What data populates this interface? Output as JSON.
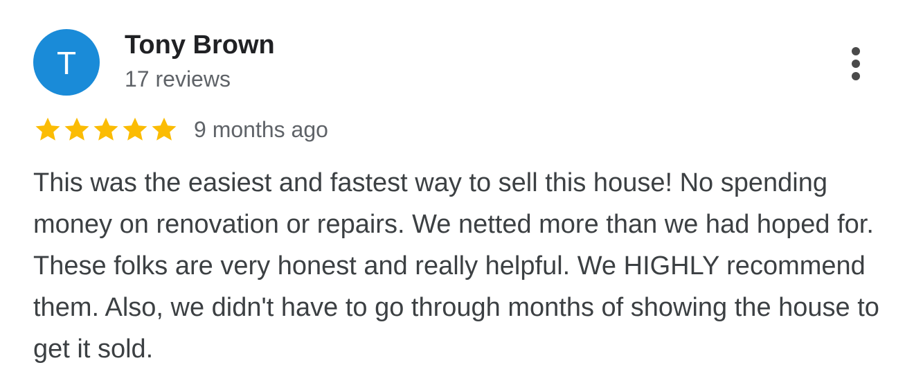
{
  "review": {
    "author": {
      "avatar_letter": "T",
      "avatar_color": "#1a8bd8",
      "name": "Tony Brown",
      "reviews_count": "17 reviews"
    },
    "menu_icon": "more-vertical-icon",
    "rating": {
      "stars_filled": 5,
      "stars_total": 5,
      "star_color": "#fbbc04",
      "star_icon": "star-icon"
    },
    "time_ago": "9 months ago",
    "text": "This was the easiest and fastest way to sell this house! No spending money on renovation or repairs. We netted more than we had hoped for. These folks are very honest and really helpful. We HIGHLY recommend them. Also, we didn't have to go through months of showing the house to get it sold."
  }
}
